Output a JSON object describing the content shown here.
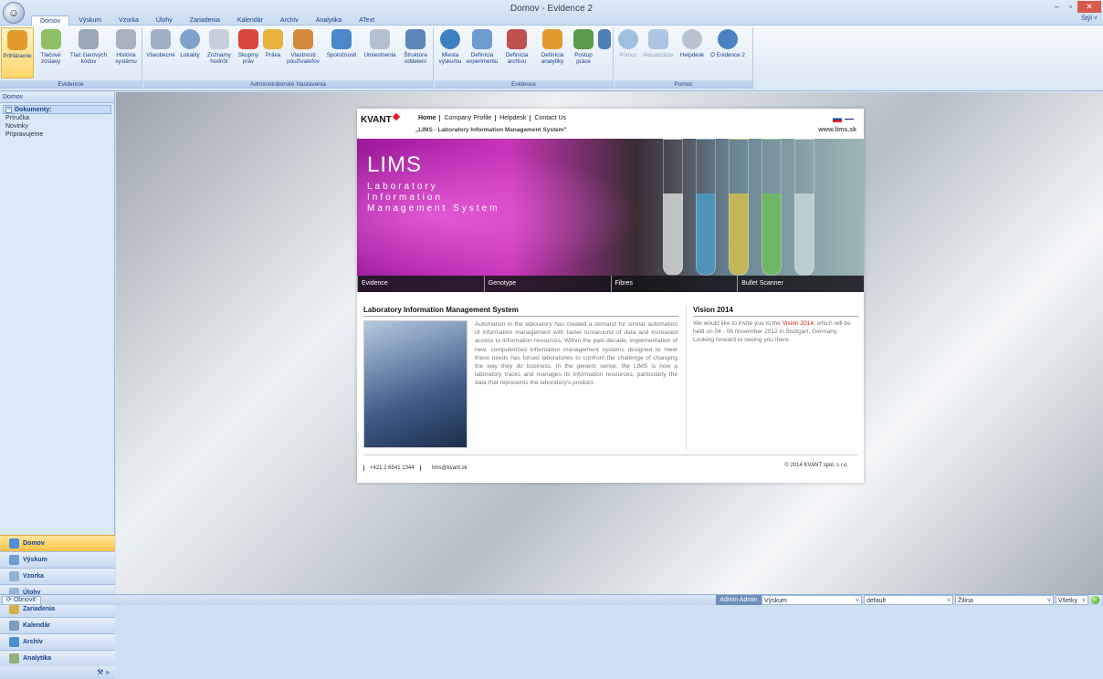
{
  "window": {
    "title": "Domov - Evidence 2",
    "minimize": "–",
    "restore": "▫",
    "close": "✕"
  },
  "tabs": [
    "Domov",
    "Výskum",
    "Vzorka",
    "Úlohy",
    "Zariadenia",
    "Kalendár",
    "Archív",
    "Analytika",
    "AText"
  ],
  "styles_menu": "Štýl ˅",
  "ribbon": {
    "groups": [
      {
        "label": "Evidencie",
        "buttons": [
          "Prihlásenie",
          "Tlačové zostavy",
          "Tlač čiarových kódov",
          "História systému"
        ]
      },
      {
        "label": "Administrátorské Nastavenia",
        "buttons": [
          "Všeobecné",
          "Lokality",
          "Zoznamy hodnôt",
          "Skupiny práv",
          "Práva",
          "Vlastnosti používateľov",
          "Spoločnosti",
          "Umiestnenia",
          "Štruktúra oddelení"
        ]
      },
      {
        "label": "Evidence",
        "buttons": [
          "Miesta výskumu",
          "Definícia experimentu",
          "Definícia archívu",
          "Definícia analytiky",
          "Postup práce"
        ]
      },
      {
        "label": "Pomoc",
        "buttons": [
          "Pomoc",
          "Aktualizácie",
          "Helpdesk",
          "O Evidence 2"
        ]
      }
    ],
    "dialog_launcher": "⌐"
  },
  "sidebar": {
    "header": "Domov",
    "tree_root": "Dokumenty:",
    "tree_items": [
      "Príručka",
      "Novinky",
      "Pripravujeme"
    ],
    "nav": [
      "Domov",
      "Výskum",
      "Vzorka",
      "Úlohy",
      "Zariadenia",
      "Kalendár",
      "Archív",
      "Analytika"
    ],
    "footer": "⚒ »"
  },
  "site": {
    "logo": "KVANT",
    "nav": [
      "Home",
      "Company Profile",
      "Helpdesk",
      "Contact Us"
    ],
    "tagline": "„LIMS - Laboratory Information Management System\"",
    "url": "www.lims.sk",
    "banner_title": "LIMS",
    "banner_subtitle": "Laboratory Information Management System",
    "banner_tabs": [
      "Evidence",
      "Genotype",
      "Fibres",
      "Bullet Scanner"
    ],
    "main_title": "Laboratory Information Management System",
    "main_text": "Automation in the laboratory has created a demand for similar automation of information management with faster turnaround of data and increased access to information resources. Within the past decade, implementation of new, computerized information management systems designed to meet these needs has forced laboratories to confront the challenge of changing the way they do business. In the generic sense, the LIMS is how a laboratory tracks and manages its information resources, particularly the data that represents the laboratory's product.",
    "side_title": "Vision 2014",
    "side_text_before": "We would like to invite you to the",
    "side_text_link": "Vision 2014",
    "side_text_after": ", which will be held on 04 - 06 November 2012 in Stuttgart, Germany. Looking forward to seeing you there.",
    "phone": "+421 2 6541 1344",
    "email": "lims@kvant.sk",
    "copyright": "© 2014 KVANT spol. s r.o."
  },
  "status": {
    "refresh": "Obnoviť",
    "user": "Admin Admin",
    "combos": [
      "Výskum",
      "default",
      "Žilina",
      "Všetky"
    ],
    "combo_arrow": "˅"
  }
}
